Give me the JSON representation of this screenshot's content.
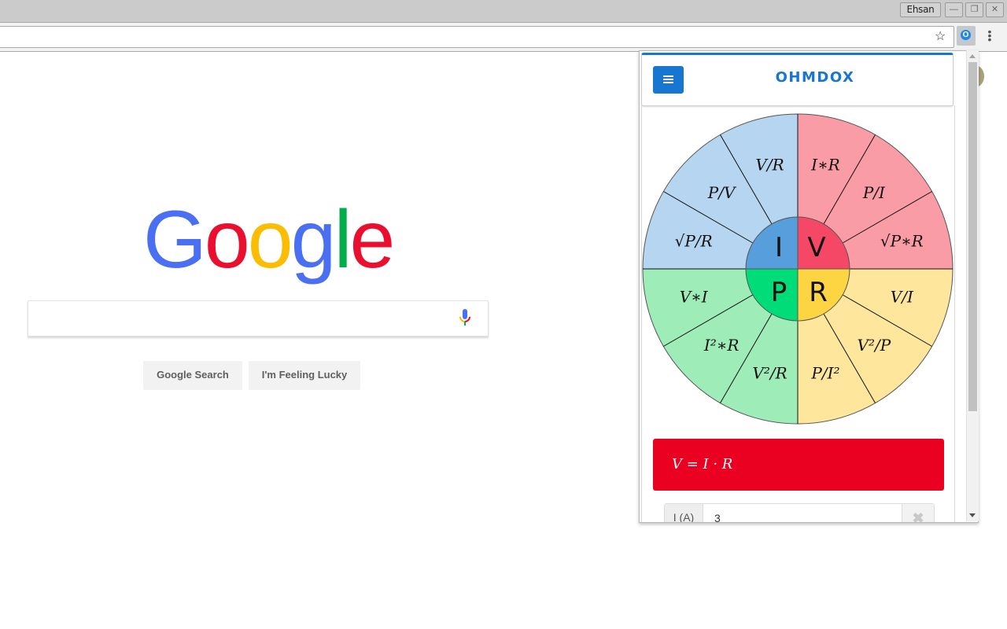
{
  "window": {
    "user_name": "Ehsan",
    "controls": {
      "minimize": "—",
      "restore": "❐",
      "close": "✕"
    }
  },
  "toolbar": {
    "address_value": "",
    "bookmark_icon": "☆",
    "extension_icon_label": "O",
    "menu_icon": "⋮"
  },
  "google": {
    "logo_letters": [
      {
        "ch": "G",
        "color": "#4a6ff2"
      },
      {
        "ch": "o",
        "color": "#ea0f2f"
      },
      {
        "ch": "o",
        "color": "#fbbd02"
      },
      {
        "ch": "g",
        "color": "#4a6ff2"
      },
      {
        "ch": "l",
        "color": "#00ad4a"
      },
      {
        "ch": "e",
        "color": "#ea0f2f"
      }
    ],
    "search_value": "",
    "search_button": "Google Search",
    "lucky_button": "I'm Feeling Lucky"
  },
  "popup": {
    "app_title": "OHMDOX",
    "accent_color": "#1776cf",
    "wheel": {
      "center_labels": {
        "I": "I",
        "V": "V",
        "P": "P",
        "R": "R"
      },
      "quadrants": {
        "I": {
          "inner": "#569fdc",
          "outer": "#b5d5f0",
          "formulas": [
            "V/R",
            "P/V",
            "√P/R"
          ]
        },
        "V": {
          "inner": "#f54866",
          "outer": "#f99ca6",
          "formulas": [
            "I∗R",
            "P/I",
            "√P∗R"
          ]
        },
        "R": {
          "inner": "#fdd442",
          "outer": "#fee79c",
          "formulas": [
            "V/I",
            "V²/P",
            "P/I²"
          ]
        },
        "P": {
          "inner": "#00dc78",
          "outer": "#9eecb8",
          "formulas": [
            "V∗I",
            "I²∗R",
            "V²/R"
          ]
        }
      }
    },
    "result_formula": "V = I · R",
    "result_color": "#ea0020",
    "inputs": [
      {
        "label": "I (A)",
        "value": "3",
        "clear_icon": "✖"
      }
    ]
  }
}
